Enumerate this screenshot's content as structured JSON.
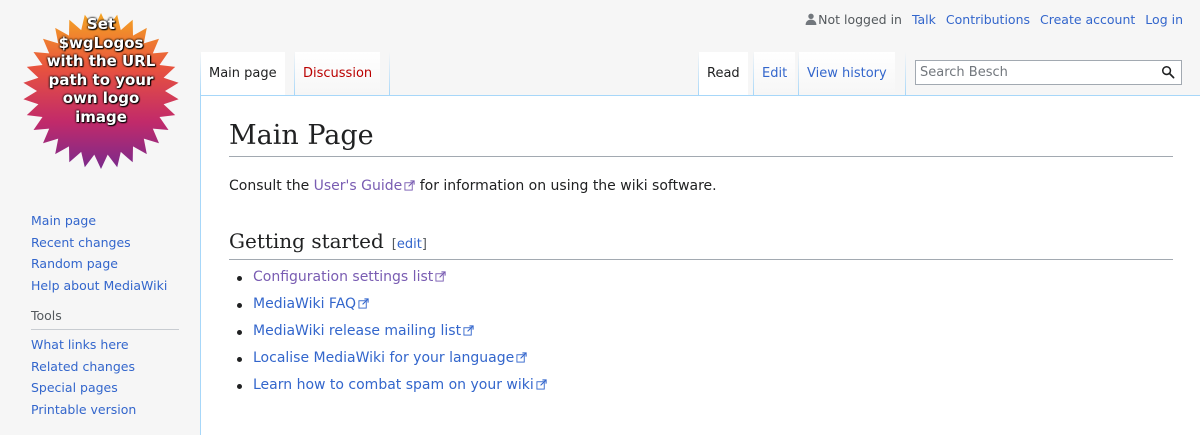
{
  "personal": {
    "not_logged_in": "Not logged in",
    "talk": "Talk",
    "contributions": "Contributions",
    "create_account": "Create account",
    "log_in": "Log in"
  },
  "logo": {
    "lines": [
      "Set",
      "$wgLogos",
      "with the URL",
      "path to your",
      "own logo",
      "image"
    ]
  },
  "tabs": {
    "main_page": "Main page",
    "discussion": "Discussion",
    "read": "Read",
    "edit": "Edit",
    "view_history": "View history"
  },
  "search": {
    "placeholder": "Search Besch"
  },
  "sidebar": {
    "navigation": [
      "Main page",
      "Recent changes",
      "Random page",
      "Help about MediaWiki"
    ],
    "tools_heading": "Tools",
    "tools": [
      "What links here",
      "Related changes",
      "Special pages",
      "Printable version"
    ]
  },
  "content": {
    "title": "Main Page",
    "intro_before": "Consult the ",
    "intro_link": "User's Guide",
    "intro_after": " for information on using the wiki software.",
    "section_heading": "Getting started",
    "edit_open": "[",
    "edit_label": "edit",
    "edit_close": "]",
    "list": [
      "Configuration settings list",
      "MediaWiki FAQ",
      "MediaWiki release mailing list",
      "Localise MediaWiki for your language",
      "Learn how to combat spam on your wiki"
    ]
  },
  "colors": {
    "link": "#3366cc",
    "visited": "#795cb2",
    "new_link": "#ba0000",
    "border": "#a7d7f9"
  }
}
